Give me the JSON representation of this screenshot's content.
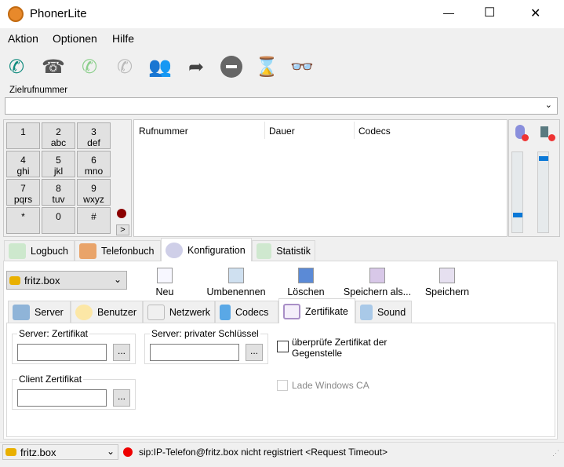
{
  "window": {
    "title": "PhonerLite",
    "minimize": "—",
    "maximize": "☐",
    "close": "✕"
  },
  "menu": [
    "Aktion",
    "Optionen",
    "Hilfe"
  ],
  "toolbar": [
    "call-icon",
    "hangup-icon",
    "callback-icon",
    "hold-icon",
    "conference-icon",
    "forward-icon",
    "block-icon",
    "wait-icon",
    "incognito-icon"
  ],
  "dial": {
    "label": "Zielrufnummer",
    "value": ""
  },
  "keypad": [
    [
      "1",
      ""
    ],
    [
      "2",
      "abc"
    ],
    [
      "3",
      "def"
    ],
    [
      "4",
      "ghi"
    ],
    [
      "5",
      "jkl"
    ],
    [
      "6",
      "mno"
    ],
    [
      "7",
      "pqrs"
    ],
    [
      "8",
      "tuv"
    ],
    [
      "9",
      "wxyz"
    ],
    [
      "*",
      ""
    ],
    [
      "0",
      ""
    ],
    [
      "#",
      ""
    ]
  ],
  "keypad_more": ">",
  "calls": {
    "columns": [
      "Rufnummer",
      "Dauer",
      "Codecs"
    ]
  },
  "volume": {
    "mic_level": 0.2,
    "speaker_level": 0.95
  },
  "tabs": [
    "Logbuch",
    "Telefonbuch",
    "Konfiguration",
    "Statistik"
  ],
  "config": {
    "profile": "fritz.box",
    "actions": [
      "Neu",
      "Umbenennen",
      "Löschen",
      "Speichern als...",
      "Speichern"
    ],
    "subtabs": [
      "Server",
      "Benutzer",
      "Netzwerk",
      "Codecs",
      "Zertifikate",
      "Sound"
    ],
    "server_cert": "Server: Zertifikat",
    "server_key": "Server: privater Schlüssel",
    "client_cert": "Client Zertifikat",
    "browse": "...",
    "verify": "überprüfe Zertifikat der Gegenstelle",
    "windows_ca": "Lade Windows CA"
  },
  "status": {
    "profile": "fritz.box",
    "message": "sip:IP-Telefon@fritz.box nicht registriert <Request Timeout>"
  }
}
